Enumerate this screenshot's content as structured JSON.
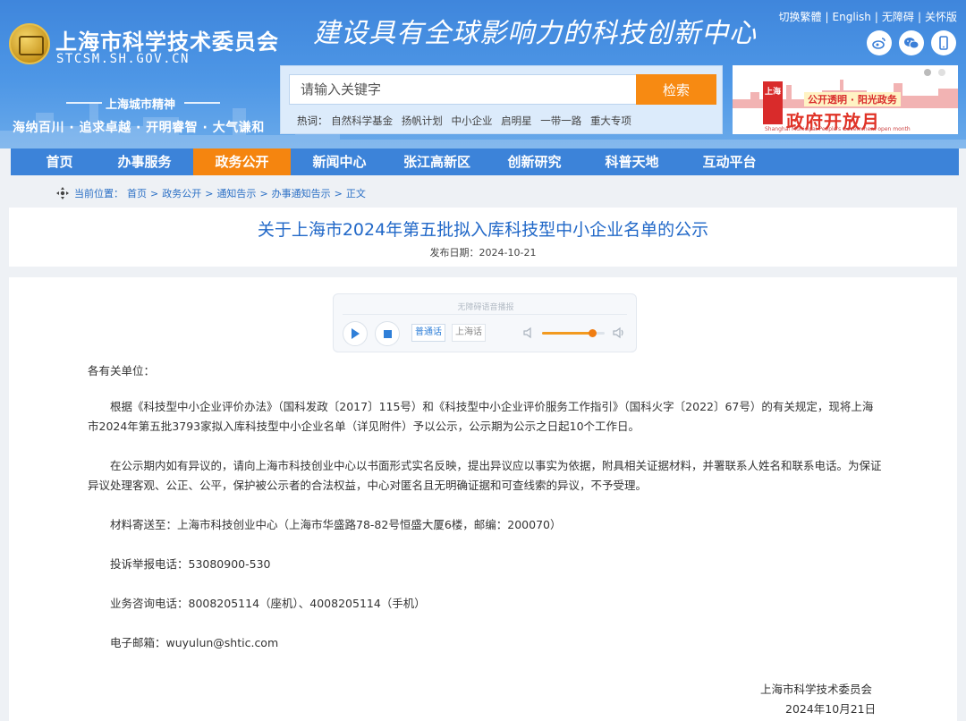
{
  "header": {
    "site_name": "上海市科学技术委员会",
    "site_domain": "STCSM.SH.GOV.CN",
    "slogan": "建设具有全球影响力的科技创新中心",
    "spirit_title": "上海城市精神",
    "spirit_text": "海纳百川 · 追求卓越 · 开明睿智 · 大气谦和",
    "logo_text": "",
    "top_links": [
      "切换繁體",
      "English",
      "无障碍",
      "关怀版"
    ],
    "social_icons": [
      "weibo-icon",
      "wechat-icon",
      "mobile-icon"
    ]
  },
  "search": {
    "placeholder": "请输入关键字",
    "button_label": "检索",
    "hot_label": "热词：",
    "hot_words": [
      "自然科学基金",
      "扬帆计划",
      "中小企业",
      "启明星",
      "一带一路",
      "重大专项"
    ]
  },
  "banner": {
    "badge": "上海",
    "subtitle": "公开透明 · 阳光政务",
    "title": "政府开放月",
    "english": "Shanghai Municipal People's Government open month"
  },
  "nav": {
    "items": [
      "首页",
      "办事服务",
      "政务公开",
      "新闻中心",
      "张江高新区",
      "创新研究",
      "科普天地",
      "互动平台"
    ],
    "active_index": 2
  },
  "breadcrumb": {
    "label": "当前位置：",
    "items": [
      "首页",
      "政务公开",
      "通知告示",
      "办事通知告示",
      "正文"
    ],
    "separator": ">"
  },
  "article": {
    "title": "关于上海市2024年第五批拟入库科技型中小企业名单的公示",
    "date_label": "发布日期：2024-10-21",
    "greeting": "各有关单位：",
    "paragraph1": "根据《科技型中小企业评价办法》（国科发政〔2017〕115号）和《科技型中小企业评价服务工作指引》（国科火字〔2022〕67号）的有关规定，现将上海市2024年第五批3793家拟入库科技型中小企业名单（详见附件）予以公示，公示期为公示之日起10个工作日。",
    "paragraph2": "在公示期内如有异议的，请向上海市科技创业中心以书面形式实名反映，提出异议应以事实为依据，附具相关证据材料，并署联系人姓名和联系电话。为保证异议处理客观、公正、公平，保护被公示者的合法权益，中心对匿名且无明确证据和可查线索的异议，不予受理。",
    "mail_to": "材料寄送至：上海市科技创业中心（上海市华盛路78-82号恒盛大厦6楼，邮编：200070）",
    "complaint_phone": "投诉举报电话：53080900-530",
    "consult_phone": "业务咨询电话：8008205114（座机）、4008205114（手机）",
    "email": "电子邮箱：wuyulun@shtic.com",
    "sign_org": "上海市科学技术委员会",
    "sign_date": "2024年10月21日"
  },
  "audio": {
    "tip": "无障碍语音播报",
    "lang_mandarin": "普通话",
    "lang_shanghai": "上海话",
    "volume": 0.8
  },
  "colors": {
    "header_blue": "#4e97e6",
    "nav_blue": "#3c83d9",
    "accent_orange": "#f5850f",
    "title_blue": "#2168c8"
  }
}
